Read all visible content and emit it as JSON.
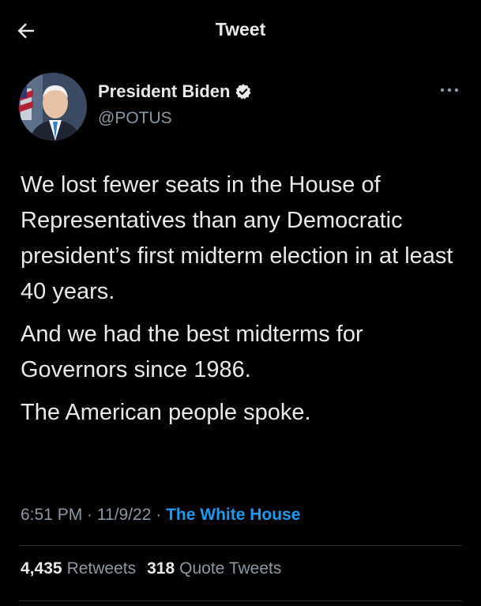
{
  "header": {
    "title": "Tweet",
    "back_icon": "arrow-left-icon"
  },
  "author": {
    "name": "President Biden",
    "handle": "@POTUS",
    "verified_icon": "verified-badge-icon",
    "more_icon": "more-horizontal-icon"
  },
  "tweet": {
    "paragraphs": [
      "We lost fewer seats in the House of Representatives than any Democratic president’s first midterm election in at least 40 years.",
      "And we had the best midterms for Governors since 1986.",
      "The American people spoke."
    ]
  },
  "meta": {
    "time": "6:51 PM",
    "separator": " · ",
    "date": "11/9/22",
    "source": "The White House"
  },
  "stats": {
    "retweets_count": "4,435",
    "retweets_label": "Retweets",
    "quotes_count": "318",
    "quotes_label": "Quote Tweets"
  },
  "colors": {
    "background": "#000000",
    "text": "#e7e9ea",
    "secondary": "#8b98a5",
    "accent": "#1d9bf0",
    "divider": "#2f3336"
  }
}
